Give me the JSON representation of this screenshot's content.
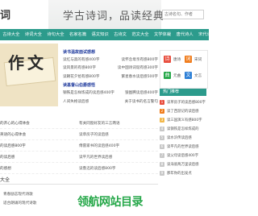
{
  "header": {
    "logo": "词",
    "slogan": "学古诗词，品读经典",
    "search_placeholder": "古诗名句、作者"
  },
  "nav": [
    "古诗大全",
    "诗词大全",
    "诗句大全",
    "名家名篇",
    "语文知识",
    "古诗文",
    "范文大全",
    "文学体裁",
    "唐代诗人",
    "宋代诗人"
  ],
  "banner": {
    "text": "作文"
  },
  "news": {
    "section1_title": "读书温故面试感想",
    "section1_items": [
      [
        "读红与黑的有感400字",
        "读怀念母亲有感800字"
      ],
      [
        "读风景的有感800字",
        "读中国诗词谐有感300字"
      ],
      [
        "读朝花夕拾有感800字",
        "繁星春水读后感500字"
      ]
    ],
    "section2_title": "读基督山伯爵感悟",
    "section2_items": [
      [
        "钢铁是怎样炼成的读后感400字",
        "狼图腾读后感400字"
      ],
      [
        "人间失格读后感",
        "关于读书的名言警句"
      ]
    ]
  },
  "list2": [
    [
      "的开心的心得体会",
      "有关同窗好友的三言两语"
    ],
    [
      "的心得体会",
      "名人名言",
      "读书破万卷下笔如有神的意思"
    ],
    [
      "的读后感500字",
      "读书笔记摘抄大全",
      "关于读书的手抄报"
    ],
    [
      "读后感",
      "诗词名句大全",
      "精彩的书摘抄400字"
    ],
    [
      "的感想",
      "描写春天的诗句",
      "读书名言警句大全"
    ]
  ],
  "list2_rows": [
    [
      "的开心的心得体会",
      "有关同窗好友的三言两语"
    ],
    [
      "英语的心得体会",
      "读草房子的读后感"
    ],
    [
      "的读后感800字",
      "傅雷家书的读后感400字"
    ],
    [
      "的读后感",
      "读平凡的世界读后感"
    ],
    [
      "的感想",
      "读鲁迅的读后感800字"
    ]
  ],
  "section": {
    "title": "大全"
  },
  "bottom_left": [
    "青春励志现代诗歌",
    "适合朗诵的现代诗歌"
  ],
  "bottom_logo": "领航网站目录",
  "sidebar": {
    "cards": [
      {
        "label": "唐诗",
        "icon": "诗",
        "color": "#e84d3d"
      },
      {
        "label": "宋词",
        "icon": "词",
        "color": "#f07d1d"
      },
      {
        "label": "元曲",
        "icon": "曲",
        "color": "#27a84a"
      },
      {
        "label": "文言",
        "icon": "文",
        "color": "#2c7fd6"
      }
    ],
    "hot_title": "热门推荐",
    "hot_items": [
      "读草房子的读后感",
      "读了西游记的读后感",
      "读三国演义有感",
      "读钢铁是怎样炼成的",
      "读水浒传读后感",
      "读西游记的读后感",
      "读平凡的世界",
      "读骆驼祥子读后感",
      "读红楼梦读后感",
      "读朝花夕拾读后感"
    ],
    "hot_items_display": [
      "读草房子的读后感800字",
      "读了西游记的读后感",
      "读三国演义有感800字",
      "读钢铁是怎样炼成的",
      "读水浒传读后感",
      "读平凡的世界读后感",
      "读父母读后感400字",
      "读海底两万里读后感",
      "那年你的出发点"
    ]
  }
}
